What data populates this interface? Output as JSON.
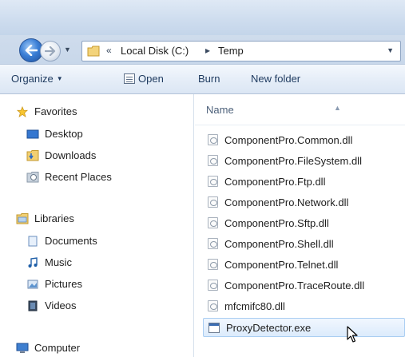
{
  "address_bar": {
    "prefix": "«",
    "path": [
      "Local Disk (C:)",
      "Temp"
    ],
    "separator": "▸"
  },
  "toolbar": {
    "organize_label": "Organize",
    "open_label": "Open",
    "burn_label": "Burn",
    "new_folder_label": "New folder"
  },
  "navigation": {
    "favorites_label": "Favorites",
    "favorites": [
      "Desktop",
      "Downloads",
      "Recent Places"
    ],
    "libraries_label": "Libraries",
    "libraries": [
      "Documents",
      "Music",
      "Pictures",
      "Videos"
    ],
    "computer_label": "Computer"
  },
  "file_list": {
    "column_name": "Name",
    "files": [
      {
        "name": "ComponentPro.Common.dll",
        "type": "dll"
      },
      {
        "name": "ComponentPro.FileSystem.dll",
        "type": "dll"
      },
      {
        "name": "ComponentPro.Ftp.dll",
        "type": "dll"
      },
      {
        "name": "ComponentPro.Network.dll",
        "type": "dll"
      },
      {
        "name": "ComponentPro.Sftp.dll",
        "type": "dll"
      },
      {
        "name": "ComponentPro.Shell.dll",
        "type": "dll"
      },
      {
        "name": "ComponentPro.Telnet.dll",
        "type": "dll"
      },
      {
        "name": "ComponentPro.TraceRoute.dll",
        "type": "dll"
      },
      {
        "name": "mfcmifc80.dll",
        "type": "dll"
      },
      {
        "name": "ProxyDetector.exe",
        "type": "exe",
        "selected": true
      }
    ]
  },
  "colors": {
    "accent": "#3b7fd6",
    "selection": "#dcebfc",
    "toolbar_text": "#1e3a5f"
  }
}
